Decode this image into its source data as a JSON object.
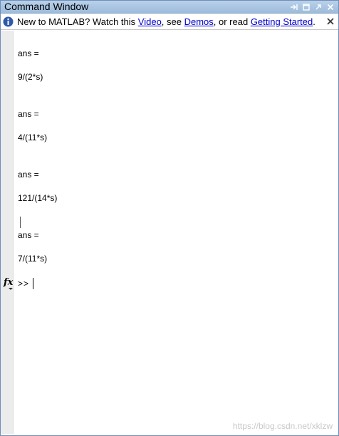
{
  "window": {
    "title": "Command Window",
    "controls": [
      "undock-icon",
      "maximize-icon",
      "arrow-icon",
      "close-icon"
    ]
  },
  "infobar": {
    "prefix": "New to MATLAB? Watch this ",
    "link_video": "Video",
    "sep1": ", see ",
    "link_demos": "Demos",
    "sep2": ", or read ",
    "link_getting_started": "Getting Started",
    "suffix": "."
  },
  "console": {
    "outputs": [
      {
        "label": "ans =",
        "value": "9/(2*s)"
      },
      {
        "label": "ans =",
        "value": "4/(11*s)"
      },
      {
        "label": "ans =",
        "value": "121/(14*s)"
      },
      {
        "label": "ans =",
        "value": "7/(11*s)"
      }
    ],
    "prompt": ">>",
    "fx_label": "fx"
  },
  "watermark": "https://blog.csdn.net/xklzw"
}
